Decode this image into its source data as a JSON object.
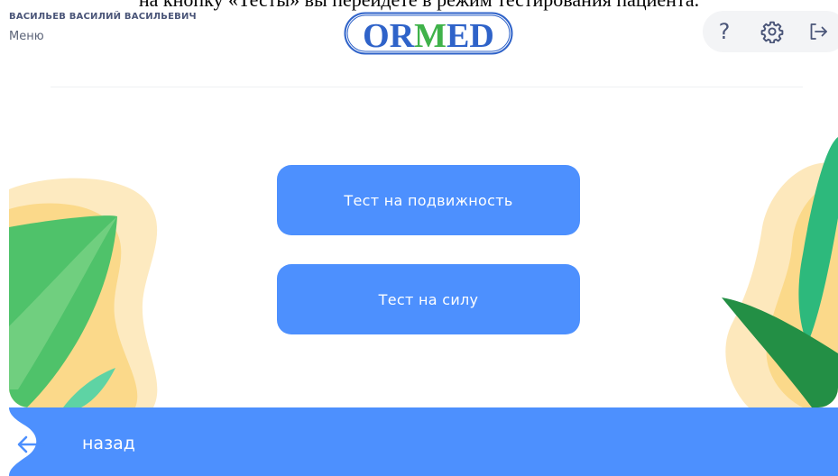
{
  "caption": "на кнопку «Тесты» вы перейдете в режим тестирования пациента.",
  "header": {
    "user_name": "ВАСИЛЬЕВ ВАСИЛИЙ ВАСИЛЬЕВИЧ",
    "menu_label": "Меню",
    "logo_text": "ORMED"
  },
  "toolbar": {
    "help_glyph": "?",
    "icons": [
      "help-icon",
      "settings-icon",
      "logout-icon"
    ]
  },
  "main": {
    "buttons": [
      {
        "label": "Тест на подвижность"
      },
      {
        "label": "Тест на силу"
      }
    ]
  },
  "footer": {
    "back_label": "назад"
  },
  "colors": {
    "accent": "#4d90fe",
    "logo_blue": "#2f63c9",
    "logo_green": "#3fb24a",
    "leaf_green": "#2e9c4e",
    "blob_yellow": "#fbd98a"
  }
}
